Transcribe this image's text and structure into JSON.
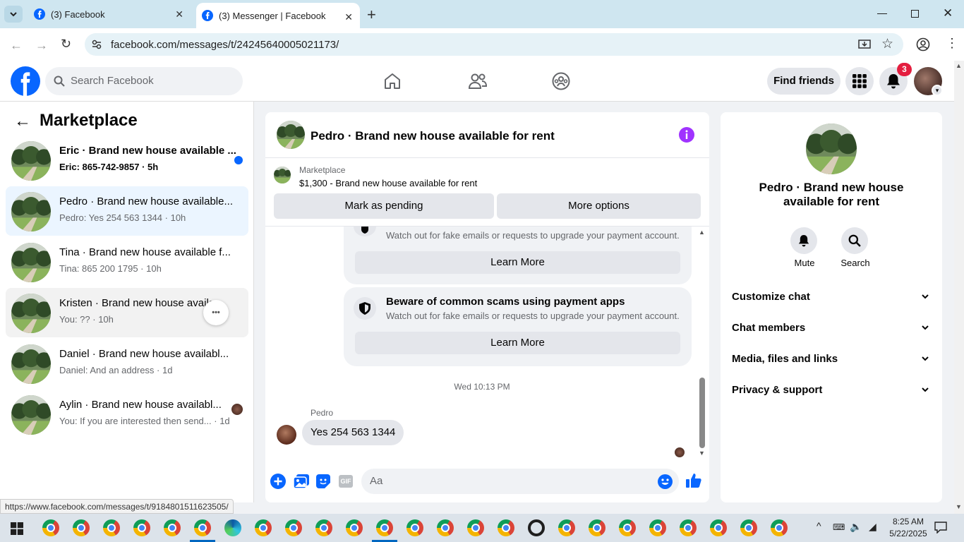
{
  "browser": {
    "tabs": [
      {
        "label": "(3) Facebook"
      },
      {
        "label": "(3) Messenger | Facebook"
      }
    ],
    "url": "facebook.com/messages/t/24245640005021173/",
    "status_url": "https://www.facebook.com/messages/t/9184801511623505/"
  },
  "header": {
    "search_placeholder": "Search Facebook",
    "find_friends": "Find friends",
    "notification_count": "3"
  },
  "sidebar": {
    "title": "Marketplace",
    "conversations": [
      {
        "name": "Eric · Brand new house available ...",
        "preview": "Eric: 865-742-9857",
        "time": "5h",
        "unread": true
      },
      {
        "name": "Pedro · Brand new house available...",
        "preview": "Pedro: Yes 254 563 1344",
        "time": "10h",
        "selected": true
      },
      {
        "name": "Tina · Brand new house available f...",
        "preview": "Tina: 865 200 1795",
        "time": "10h"
      },
      {
        "name": "Kristen · Brand new house availa...",
        "preview": "You: ??",
        "time": "10h",
        "hovered": true
      },
      {
        "name": "Daniel · Brand new house availabl...",
        "preview": "Daniel: And an address",
        "time": "1d"
      },
      {
        "name": "Aylin · Brand new house availabl...",
        "preview": "You: If you are interested then send...",
        "time": "1d"
      }
    ]
  },
  "chat": {
    "title": "Pedro · Brand new house available for rent",
    "listing_source": "Marketplace",
    "listing": "$1,300 - Brand new house available for rent",
    "mark_pending": "Mark as pending",
    "more_options": "More options",
    "scam_cards": [
      {
        "title": "",
        "body": "Watch out for fake emails or requests to upgrade your payment account.",
        "button": "Learn More"
      },
      {
        "title": "Beware of common scams using payment apps",
        "body": "Watch out for fake emails or requests to upgrade your payment account.",
        "button": "Learn More"
      }
    ],
    "timestamp": "Wed 10:13 PM",
    "sender": "Pedro",
    "message": "Yes 254 563 1344",
    "composer_placeholder": "Aa"
  },
  "details": {
    "title": "Pedro · Brand new house available for rent",
    "mute": "Mute",
    "search": "Search",
    "sections": [
      "Customize chat",
      "Chat members",
      "Media, files and links",
      "Privacy & support"
    ]
  },
  "taskbar": {
    "time": "8:25 AM",
    "date": "5/22/2025"
  },
  "colors": {
    "facebook_blue": "#0866ff",
    "messenger_purple": "#a033ff",
    "unread_dot": "#0866ff",
    "badge_red": "#e41e3f"
  }
}
